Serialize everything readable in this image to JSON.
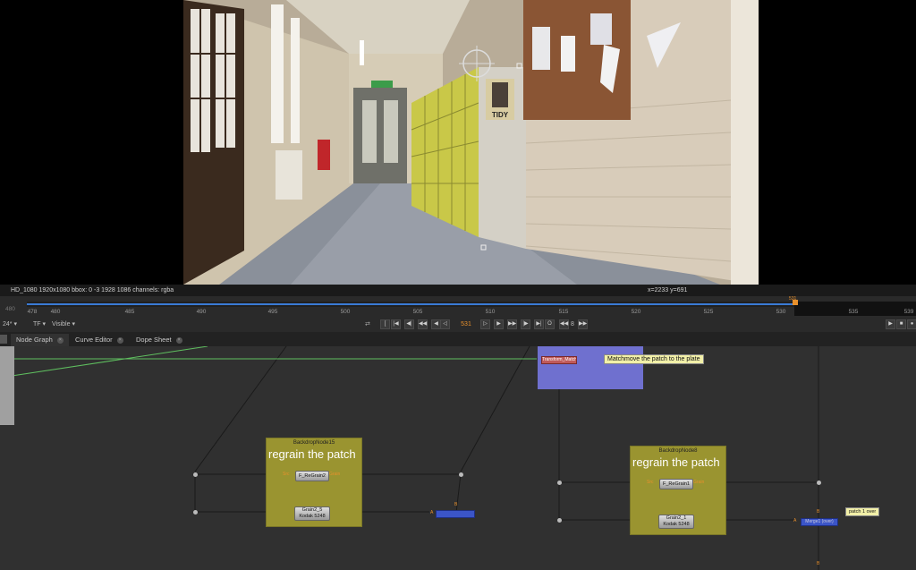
{
  "viewer": {
    "info_left": "HD_1080 1920x1080  bbox: 0 -3 1928 1086 channels: rgba",
    "info_right": "x=2233 y=691",
    "poster_text": "TIDY"
  },
  "timeline": {
    "start_label": "480",
    "ticks": [
      "478",
      "480",
      "485",
      "490",
      "495",
      "500",
      "505",
      "510",
      "515",
      "520",
      "525",
      "530",
      "535",
      "539"
    ],
    "current_marker": "531"
  },
  "transport": {
    "fps": "24*",
    "tf": "TF",
    "visible": "Visible",
    "frame": "531",
    "step": "8",
    "buttons": [
      "first-frame",
      "prev-key",
      "prev-increment",
      "prev-frame",
      "play-backward",
      "play-forward",
      "next-frame",
      "next-increment",
      "next-key",
      "last-frame",
      "loop"
    ]
  },
  "tabs": [
    {
      "label": "Node Graph",
      "active": true
    },
    {
      "label": "Curve Editor",
      "active": false
    },
    {
      "label": "Dope Sheet",
      "active": false
    }
  ],
  "graph": {
    "backdrop1": {
      "title": "BackdropNode15",
      "label": "regrain the patch",
      "node_regrain": "F_ReGrain2",
      "node_grain_line1": "Grain2_5",
      "node_grain_line2": "Kodak 5248"
    },
    "backdrop2": {
      "title": "BackdropNode8",
      "label": "regrain the patch",
      "node_regrain": "F_ReGrain1",
      "node_grain_line1": "Grain2_1",
      "node_grain_line2": "Kodak 5248"
    },
    "matchmove_node": "Transform_MatchMove1",
    "matchmove_tooltip": "Matchmove the patch to the plate",
    "merge_tooltip": "patch 1 over",
    "merge_node": "Merge1 (over)",
    "input_labels": {
      "src": "Src",
      "grain": "Grain",
      "a": "A",
      "b": "B"
    }
  }
}
